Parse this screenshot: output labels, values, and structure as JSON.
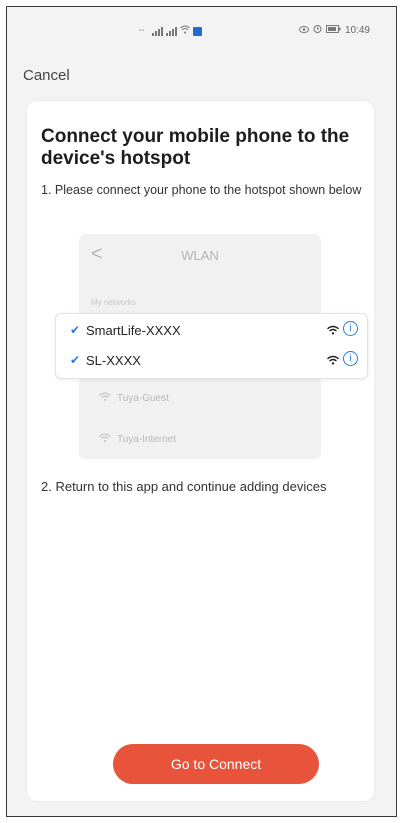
{
  "status_bar": {
    "time": "10:49",
    "battery": "▯"
  },
  "header": {
    "cancel_label": "Cancel"
  },
  "card": {
    "title": "Connect your mobile phone to the device's hotspot",
    "step1": "1. Please connect your phone to the hotspot shown below",
    "step2": "2. Return to this app and continue adding devices"
  },
  "wlan_preview": {
    "back_glyph": "<",
    "title": "WLAN",
    "my_networks_label": "My networks",
    "networks": [
      {
        "name": "SmartLife-XXXX",
        "checked": true
      },
      {
        "name": "SL-XXXX",
        "checked": true
      }
    ],
    "other_networks": [
      "Tuya-Guest",
      "Tuya-Internet"
    ]
  },
  "actions": {
    "connect_label": "Go to Connect"
  },
  "colors": {
    "accent": "#e8533b",
    "link_blue": "#2f7ad8"
  },
  "icons": {
    "check": "check-icon",
    "wifi": "wifi-icon",
    "info": "info-icon",
    "back": "chevron-left-icon"
  }
}
